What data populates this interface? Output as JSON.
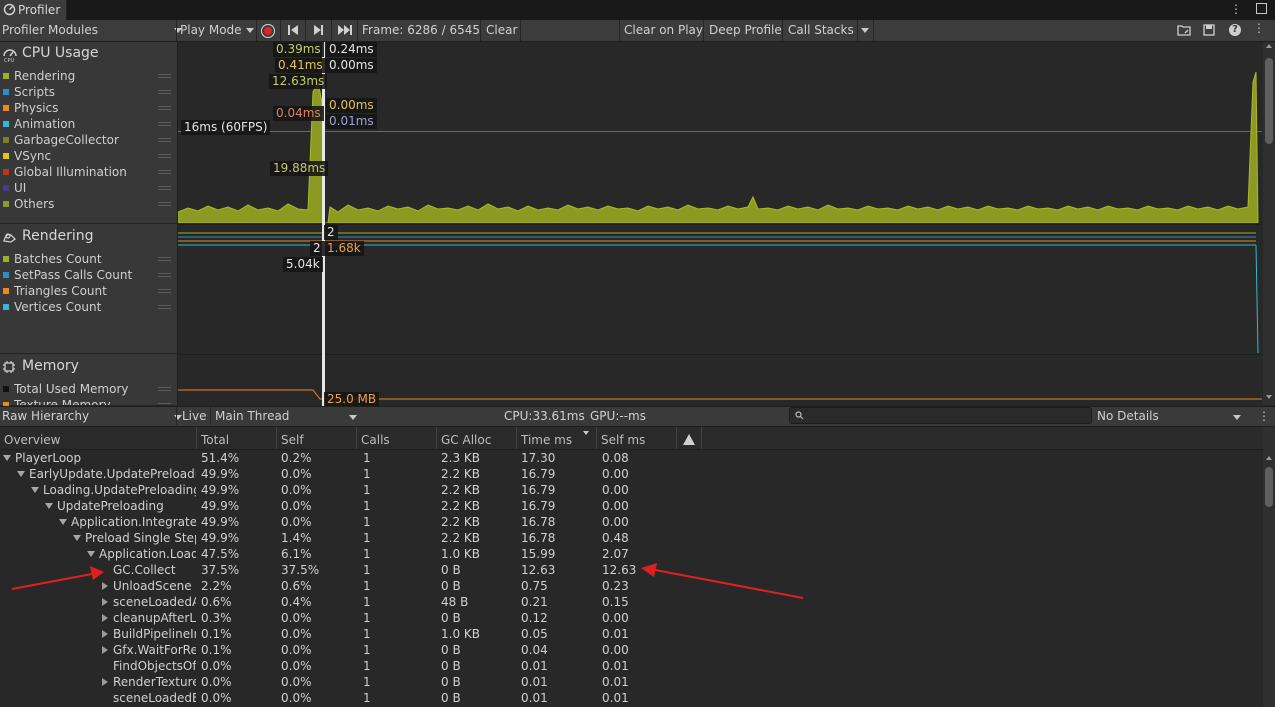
{
  "window": {
    "tab_title": "Profiler"
  },
  "toolbar": {
    "modules_label": "Profiler Modules",
    "play_mode_label": "Play Mode",
    "frame_label": "Frame: 6286 / 6545",
    "clear_label": "Clear",
    "clear_on_play_label": "Clear on Play",
    "deep_profile_label": "Deep Profile",
    "call_stacks_label": "Call Stacks"
  },
  "modules": {
    "cpu": {
      "title": "CPU Usage",
      "legend": [
        {
          "label": "Rendering",
          "color": "#9cb121"
        },
        {
          "label": "Scripts",
          "color": "#2d8fc7"
        },
        {
          "label": "Physics",
          "color": "#e88a1c"
        },
        {
          "label": "Animation",
          "color": "#35b7cf"
        },
        {
          "label": "GarbageCollector",
          "color": "#7d7d27"
        },
        {
          "label": "VSync",
          "color": "#e2c418"
        },
        {
          "label": "Global Illumination",
          "color": "#c0321e"
        },
        {
          "label": "UI",
          "color": "#4b3a8b"
        },
        {
          "label": "Others",
          "color": "#8a9a36"
        }
      ],
      "fps_marker": "16ms (60FPS)",
      "tooltips": [
        "0.39ms",
        "0.24ms",
        "0.41ms",
        "0.00ms",
        "12.63ms",
        "0.04ms",
        "0.00ms",
        "0.01ms",
        "19.88ms"
      ]
    },
    "rendering": {
      "title": "Rendering",
      "legend": [
        {
          "label": "Batches Count",
          "color": "#9cb121"
        },
        {
          "label": "SetPass Calls Count",
          "color": "#2d8fc7"
        },
        {
          "label": "Triangles Count",
          "color": "#e88a1c"
        },
        {
          "label": "Vertices Count",
          "color": "#35b7cf"
        }
      ],
      "tooltips": [
        "2",
        "2",
        "1.68k",
        "5.04k"
      ]
    },
    "memory": {
      "title": "Memory",
      "legend": [
        {
          "label": "Total Used Memory",
          "color": "#111111"
        },
        {
          "label": "Texture Memory",
          "color": "#e88a1c"
        }
      ],
      "tooltips": [
        "25.0 MB"
      ]
    }
  },
  "details_bar": {
    "view_label": "Raw Hierarchy",
    "live_label": "Live",
    "thread_label": "Main Thread",
    "cpu_label": "CPU:33.61ms",
    "gpu_label": "GPU:--ms",
    "details_label": "No Details"
  },
  "table": {
    "columns": [
      "Overview",
      "Total",
      "Self",
      "Calls",
      "GC Alloc",
      "Time ms",
      "Self ms"
    ],
    "rows": [
      {
        "name": "PlayerLoop",
        "depth": 0,
        "arrow": "down",
        "total": "51.4%",
        "self": "0.2%",
        "calls": "1",
        "gc": "2.3 KB",
        "time": "17.30",
        "selfms": "0.08"
      },
      {
        "name": "EarlyUpdate.UpdatePreloadin",
        "depth": 1,
        "arrow": "down",
        "total": "49.9%",
        "self": "0.0%",
        "calls": "1",
        "gc": "2.2 KB",
        "time": "16.79",
        "selfms": "0.00"
      },
      {
        "name": "Loading.UpdatePreloading",
        "depth": 2,
        "arrow": "down",
        "total": "49.9%",
        "self": "0.0%",
        "calls": "1",
        "gc": "2.2 KB",
        "time": "16.79",
        "selfms": "0.00"
      },
      {
        "name": "UpdatePreloading",
        "depth": 3,
        "arrow": "down",
        "total": "49.9%",
        "self": "0.0%",
        "calls": "1",
        "gc": "2.2 KB",
        "time": "16.79",
        "selfms": "0.00"
      },
      {
        "name": "Application.Integrate A",
        "depth": 4,
        "arrow": "down",
        "total": "49.9%",
        "self": "0.0%",
        "calls": "1",
        "gc": "2.2 KB",
        "time": "16.78",
        "selfms": "0.00"
      },
      {
        "name": "Preload Single Step",
        "depth": 5,
        "arrow": "down",
        "total": "49.9%",
        "self": "1.4%",
        "calls": "1",
        "gc": "2.2 KB",
        "time": "16.78",
        "selfms": "0.48"
      },
      {
        "name": "Application.LoadL",
        "depth": 6,
        "arrow": "down",
        "total": "47.5%",
        "self": "6.1%",
        "calls": "1",
        "gc": "1.0 KB",
        "time": "15.99",
        "selfms": "2.07"
      },
      {
        "name": "GC.Collect",
        "depth": 7,
        "arrow": "none",
        "total": "37.5%",
        "self": "37.5%",
        "calls": "1",
        "gc": "0 B",
        "time": "12.63",
        "selfms": "12.63"
      },
      {
        "name": "UnloadScene",
        "depth": 7,
        "arrow": "right",
        "total": "2.2%",
        "self": "0.6%",
        "calls": "1",
        "gc": "0 B",
        "time": "0.75",
        "selfms": "0.23"
      },
      {
        "name": "sceneLoadedA",
        "depth": 7,
        "arrow": "right",
        "total": "0.6%",
        "self": "0.4%",
        "calls": "1",
        "gc": "48 B",
        "time": "0.21",
        "selfms": "0.15"
      },
      {
        "name": "cleanupAfterLo",
        "depth": 7,
        "arrow": "right",
        "total": "0.3%",
        "self": "0.0%",
        "calls": "1",
        "gc": "0 B",
        "time": "0.12",
        "selfms": "0.00"
      },
      {
        "name": "BuildPipelineIn",
        "depth": 7,
        "arrow": "right",
        "total": "0.1%",
        "self": "0.0%",
        "calls": "1",
        "gc": "1.0 KB",
        "time": "0.05",
        "selfms": "0.01"
      },
      {
        "name": "Gfx.WaitForRen",
        "depth": 7,
        "arrow": "right",
        "total": "0.1%",
        "self": "0.0%",
        "calls": "1",
        "gc": "0 B",
        "time": "0.04",
        "selfms": "0.00"
      },
      {
        "name": "FindObjectsOf",
        "depth": 7,
        "arrow": "none",
        "total": "0.0%",
        "self": "0.0%",
        "calls": "1",
        "gc": "0 B",
        "time": "0.01",
        "selfms": "0.01"
      },
      {
        "name": "RenderTexture",
        "depth": 7,
        "arrow": "right",
        "total": "0.0%",
        "self": "0.0%",
        "calls": "1",
        "gc": "0 B",
        "time": "0.01",
        "selfms": "0.01"
      },
      {
        "name": "sceneLoadedB",
        "depth": 7,
        "arrow": "none",
        "total": "0.0%",
        "self": "0.0%",
        "calls": "1",
        "gc": "0 B",
        "time": "0.01",
        "selfms": "0.01"
      }
    ]
  },
  "annotations": {
    "arrow_color": "#e02020"
  }
}
